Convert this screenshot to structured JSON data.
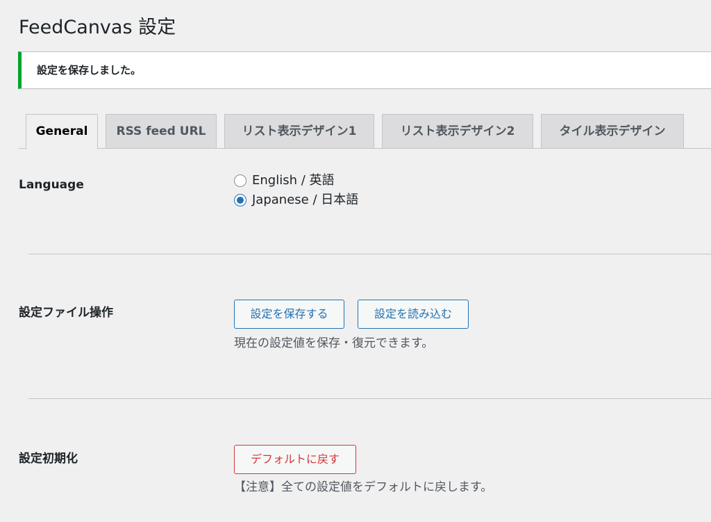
{
  "page": {
    "title": "FeedCanvas 設定"
  },
  "notice": {
    "message": "設定を保存しました。",
    "color": "#00a32a"
  },
  "tabs": [
    {
      "label": "General",
      "active": true
    },
    {
      "label": "RSS feed URL",
      "active": false
    },
    {
      "label": "リスト表示デザイン1",
      "active": false
    },
    {
      "label": "リスト表示デザイン2",
      "active": false
    },
    {
      "label": "タイル表示デザイン",
      "active": false
    }
  ],
  "language": {
    "label": "Language",
    "options": [
      {
        "label": "English / 英語",
        "checked": false
      },
      {
        "label": "Japanese / 日本語",
        "checked": true
      }
    ]
  },
  "settings_file": {
    "label": "設定ファイル操作",
    "save_button": "設定を保存する",
    "load_button": "設定を読み込む",
    "description": "現在の設定値を保存・復元できます。"
  },
  "reset": {
    "label": "設定初期化",
    "button": "デフォルトに戻す",
    "description": "【注意】全ての設定値をデフォルトに戻します。"
  },
  "colors": {
    "accent": "#2271b1",
    "danger": "#d63638",
    "success": "#00a32a",
    "background": "#f0f0f1"
  }
}
